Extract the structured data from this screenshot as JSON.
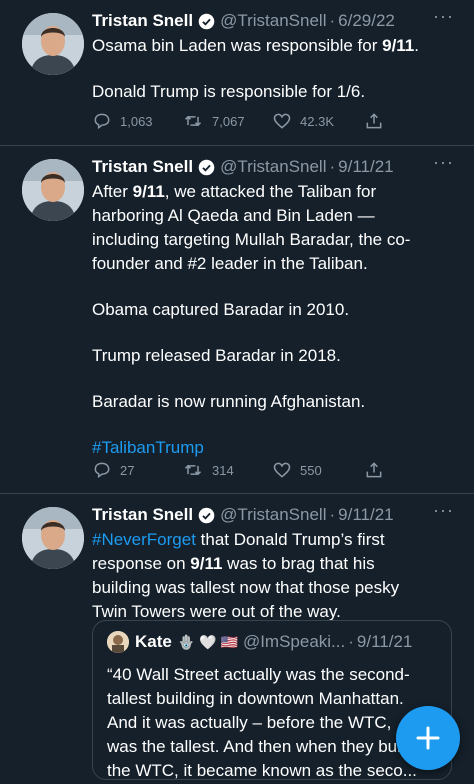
{
  "tweets": [
    {
      "name": "Tristan Snell",
      "handle": "@TristanSnell",
      "sep": "·",
      "date": "6/29/22",
      "more": "···",
      "lines": [
        [
          "Osama bin Laden was responsible for ",
          "9/11",
          "."
        ],
        "Donald Trump is responsible for 1/6."
      ],
      "replies": "1,063",
      "retweets": "7,067",
      "likes": "42.3K"
    },
    {
      "name": "Tristan Snell",
      "handle": "@TristanSnell",
      "sep": "·",
      "date": "9/11/21",
      "more": "···",
      "line1_a": "After ",
      "line1_b": "9/11",
      "line1_c": ", we attacked the Taliban for",
      "line2": "harboring Al Qaeda and Bin Laden —",
      "line3": "including targeting Mullah Baradar, the co-",
      "line4": "founder and #2 leader in the Taliban.",
      "line5": "Obama captured Baradar in 2010.",
      "line6": "Trump released Baradar in 2018.",
      "line7": "Baradar is now running Afghanistan.",
      "hashtag": "#TalibanTrump",
      "replies": "27",
      "retweets": "314",
      "likes": "550"
    },
    {
      "name": "Tristan Snell",
      "handle": "@TristanSnell",
      "sep": "·",
      "date": "9/11/21",
      "more": "···",
      "hashtag": "#NeverForget",
      "line1_rest": " that Donald Trump’s first",
      "line2_a": "response on ",
      "line2_b": "9/11",
      "line2_c": " was to brag that his",
      "line3": "building was tallest now that those pesky",
      "line4": "Twin Towers were out of the way.",
      "quote": {
        "name": "Kate",
        "emojis": "🪬 🤍 🇺🇸",
        "handle": "@ImSpeaki...",
        "sep": "·",
        "date": "9/11/21",
        "line1": "“40 Wall Street actually was the second-",
        "line2": "tallest building in downtown Manhattan.",
        "line3": "And it was actually – before the WTC,",
        "line4": "was the tallest. And then when they built",
        "line5": "the WTC, it became known as the seco..."
      }
    }
  ],
  "fab": {
    "icon": "plus-icon",
    "color": "#1d9bf0"
  },
  "colors": {
    "background": "#15202b",
    "muted": "#8b98a5",
    "accent": "#1d9bf0",
    "divider": "#38444d"
  }
}
